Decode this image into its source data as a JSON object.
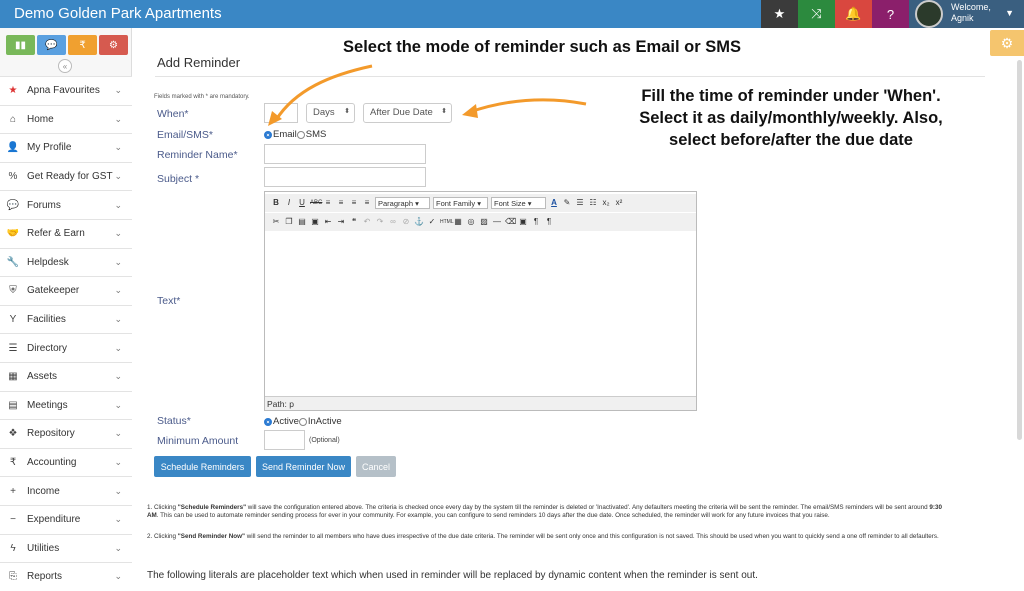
{
  "app": {
    "title": "Demo Golden Park Apartments"
  },
  "user": {
    "welcome": "Welcome,",
    "name": "Agnik"
  },
  "sidebar": {
    "items": [
      {
        "label": "Apna Favourites",
        "icon": "star-icon",
        "glyph": "★"
      },
      {
        "label": "Home",
        "icon": "home-icon",
        "glyph": "⌂"
      },
      {
        "label": "My Profile",
        "icon": "user-icon",
        "glyph": "👤"
      },
      {
        "label": "Get Ready for GST",
        "icon": "percent-icon",
        "glyph": "%"
      },
      {
        "label": "Forums",
        "icon": "chat-icon",
        "glyph": "💬"
      },
      {
        "label": "Refer & Earn",
        "icon": "handshake-icon",
        "glyph": "🤝"
      },
      {
        "label": "Helpdesk",
        "icon": "wrench-icon",
        "glyph": "🔧"
      },
      {
        "label": "Gatekeeper",
        "icon": "shield-icon",
        "glyph": "⛨"
      },
      {
        "label": "Facilities",
        "icon": "cocktail-icon",
        "glyph": "Y"
      },
      {
        "label": "Directory",
        "icon": "list-icon",
        "glyph": "☰"
      },
      {
        "label": "Assets",
        "icon": "building-icon",
        "glyph": "▦"
      },
      {
        "label": "Meetings",
        "icon": "calendar-icon",
        "glyph": "▤"
      },
      {
        "label": "Repository",
        "icon": "dropbox-icon",
        "glyph": "❖"
      },
      {
        "label": "Accounting",
        "icon": "rupee-icon",
        "glyph": "₹"
      },
      {
        "label": "Income",
        "icon": "plus-icon",
        "glyph": "+"
      },
      {
        "label": "Expenditure",
        "icon": "minus-icon",
        "glyph": "−"
      },
      {
        "label": "Utilities",
        "icon": "bolt-icon",
        "glyph": "ϟ"
      },
      {
        "label": "Reports",
        "icon": "report-icon",
        "glyph": "⎘"
      }
    ]
  },
  "form": {
    "title": "Add Reminder",
    "mandatory_note": "Fields marked with * are mandatory.",
    "when_label": "When*",
    "when_unit": "Days",
    "when_relative": "After Due Date",
    "mode_label": "Email/SMS*",
    "mode_email": "Email",
    "mode_sms": "SMS",
    "name_label": "Reminder Name*",
    "subject_label": "Subject *",
    "text_label": "Text*",
    "status_label": "Status*",
    "status_active": "Active",
    "status_inactive": "InActive",
    "min_amount_label": "Minimum Amount",
    "optional": "(Optional)",
    "editor": {
      "paragraph": "Paragraph",
      "font_family": "Font Family",
      "font_size": "Font Size",
      "path": "Path: p"
    }
  },
  "buttons": {
    "schedule": "Schedule Reminders",
    "send_now": "Send Reminder Now",
    "cancel": "Cancel"
  },
  "notes": {
    "n1_pre": "1. Clicking ",
    "n1_bold": "\"Schedule Reminders\"",
    "n1_mid": " will save the configuration entered above. The criteria is checked once every day by the system till the reminder is deleted or 'Inactivated'. Any defaulters meeting the criteria will be sent the reminder. The email/SMS reminders will be sent around ",
    "n1_time": "9:30 AM",
    "n1_post": ". This can be used to automate reminder sending process for ever in your community. For example, you can configure to send reminders 10 days after the due date. Once scheduled, the reminder will work for any future invoices that you raise.",
    "n2_pre": "2. Clicking ",
    "n2_bold": "\"Send Reminder Now\"",
    "n2_post": " will send the reminder to all members who have dues irrespective of the due date criteria. The reminder will be sent only once and this configuration is not saved. This should be used when you want to quickly send a one off reminder to all defaulters.",
    "literals": "The following literals are placeholder text which when used in reminder will be replaced by dynamic content when the reminder is sent out."
  },
  "callouts": {
    "mode": "Select the mode of reminder such as Email or SMS",
    "when_1": "Fill the time of reminder under 'When'.",
    "when_2": "Select it as daily/monthly/weekly. Also,",
    "when_3": "select before/after the due date"
  },
  "colors": {
    "accent": "#3a87c5",
    "arrow": "#f39a2b"
  }
}
